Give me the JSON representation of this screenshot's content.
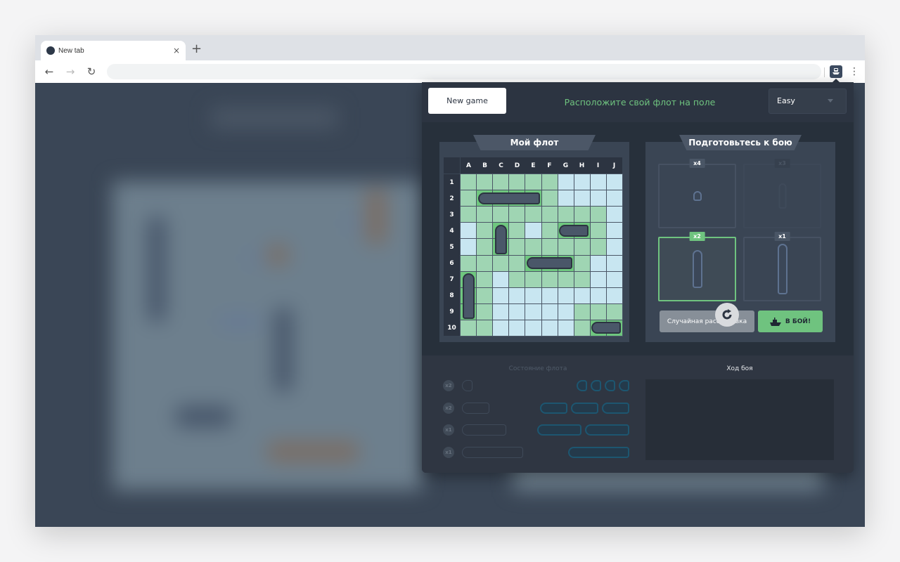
{
  "browser": {
    "tab_title": "New tab",
    "tab_close": "×",
    "new_tab": "+",
    "back": "←",
    "forward": "→",
    "reload": "↻",
    "menu": "⋮",
    "address_value": "",
    "extension_icon": "ship-icon"
  },
  "popup": {
    "new_game_label": "New game",
    "message": "Расположите свой флот на поле",
    "difficulty": {
      "selected": "Easy"
    },
    "colors": {
      "accent": "#6fc37f",
      "panel": "#3a4554",
      "background": "#2c3441"
    }
  },
  "my_fleet": {
    "title": "Мой флот",
    "columns": [
      "A",
      "B",
      "C",
      "D",
      "E",
      "F",
      "G",
      "H",
      "I",
      "J"
    ],
    "rows": [
      "1",
      "2",
      "3",
      "4",
      "5",
      "6",
      "7",
      "8",
      "9",
      "10"
    ],
    "legend": {
      "occupied_zone": "#9fd5b3",
      "free": "#c8e6f1",
      "ship": "#4a5769"
    },
    "cells": [
      "ZZZZZZFFFF",
      "ZSSSSZFFFF",
      "ZZZZZZZZZF",
      "FZSZFZSSZF",
      "FZSZZZZZZF",
      "ZZZZSSSZFF",
      "SZFZZZZZFF",
      "SZFFFFFFFF",
      "SZFFFFFZZZ",
      "ZZFFFFFZSS"
    ],
    "ships": [
      {
        "size": 4,
        "start": "B2",
        "orientation": "horizontal"
      },
      {
        "size": 2,
        "start": "C4",
        "orientation": "vertical"
      },
      {
        "size": 2,
        "start": "G4",
        "orientation": "horizontal"
      },
      {
        "size": 3,
        "start": "E6",
        "orientation": "horizontal"
      },
      {
        "size": 3,
        "start": "A7",
        "orientation": "vertical"
      },
      {
        "size": 2,
        "start": "I10",
        "orientation": "horizontal"
      }
    ]
  },
  "prepare": {
    "title": "Подготовьтесь к бою",
    "slots": [
      {
        "count": "x4",
        "size": 1,
        "state": "available"
      },
      {
        "count": "x3",
        "size": 2,
        "state": "disabled"
      },
      {
        "count": "x2",
        "size": 3,
        "state": "selected"
      },
      {
        "count": "x1",
        "size": 4,
        "state": "available"
      }
    ],
    "rotate_icon": "rotate-icon",
    "random_label": "Случайная расстановка",
    "battle_label": "В БОЙ!",
    "battle_icon": "battleship-icon"
  },
  "fleet_status": {
    "title": "Состояние флота",
    "rows": [
      {
        "count": "x2",
        "size": 1,
        "enemy_remaining": 4
      },
      {
        "count": "x2",
        "size": 2,
        "enemy_remaining": 3
      },
      {
        "count": "x1",
        "size": 3,
        "enemy_remaining": 2
      },
      {
        "count": "x1",
        "size": 4,
        "enemy_remaining": 1
      }
    ]
  },
  "battle_log": {
    "title": "Ход боя",
    "entries": []
  }
}
